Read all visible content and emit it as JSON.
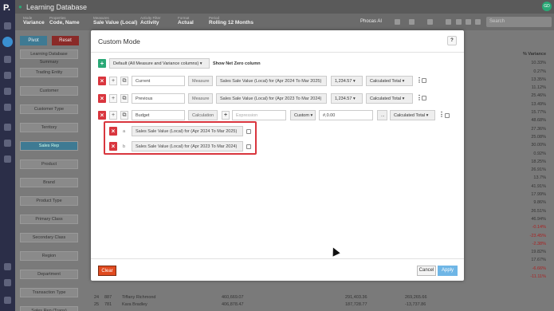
{
  "app": {
    "logo": "P.",
    "title": "Learning Database",
    "avatar": "GD"
  },
  "filters": [
    {
      "label": "Mode",
      "value": "Variance"
    },
    {
      "label": "Properties",
      "value": "Code, Name"
    },
    {
      "label": "Measures",
      "value": "Sale Value (Local)"
    },
    {
      "label": "Activity Filter",
      "value": "Activity"
    },
    {
      "label": "Format",
      "value": "Actual"
    },
    {
      "label": "Period",
      "value": "Rolling 12 Months"
    }
  ],
  "toolbar": {
    "phocas_ai": "Phocas AI",
    "search_placeholder": "Search"
  },
  "background": {
    "pivot_label": "Pivot",
    "reset_label": "Reset",
    "sidebar": [
      "Learning Database Summary",
      "Trading Entity",
      "Customer",
      "Customer Type",
      "Territory",
      "Sales Rep",
      "Product",
      "Brand",
      "Product Type",
      "Primary Class",
      "Secondary Class",
      "Region",
      "Department",
      "Transaction Type",
      "Sales Rep (Trans)"
    ],
    "variance_header": "% Variance",
    "variance_values": [
      "10.33%",
      "0.27%",
      "13.35%",
      "11.12%",
      "25.46%",
      "13.49%",
      "15.77%",
      "48.68%",
      "27.36%",
      "25.08%",
      "30.00%",
      "0.92%",
      "18.25%",
      "26.91%",
      "13.7%",
      "41.91%",
      "17.99%",
      "9.86%",
      "26.51%",
      "46.94%",
      "-0.14%",
      "-23.45%",
      "-2.38%",
      "19.82%",
      "17.67%",
      "-6.66%",
      "-11.11%"
    ],
    "rows": [
      {
        "num": "24",
        "code": "887",
        "name": "Tiffany Richmond",
        "a": "460,669.07",
        "b": "291,403.36",
        "c": "269,265.66"
      },
      {
        "num": "25",
        "code": "781",
        "name": "Kara Bradley",
        "a": "406,878.47",
        "b": "187,728.77",
        "c": "-13,737.86"
      }
    ]
  },
  "modal": {
    "title": "Custom Mode",
    "help_label": "?",
    "default_dropdown": "Default (All Measure and Variance columns)",
    "show_net_zero": "Show Net Zero column",
    "rows": [
      {
        "name": "Current",
        "type": "Measure",
        "measure": "Sales Sale Value (Local) for (Apr 2024 To Mar 2025)",
        "format": "1,234.57",
        "total": "Calculated Total"
      },
      {
        "name": "Previous",
        "type": "Measure",
        "measure": "Sales Sale Value (Local) for (Apr 2023 To Mar 2024)",
        "format": "1,234.57",
        "total": "Calculated Total"
      },
      {
        "name": "Budget",
        "type": "Calculation",
        "expression_placeholder": "Expression",
        "format_type": "Custom",
        "format": "#,0.00",
        "ellipsis": "...",
        "total": "Calculated Total"
      }
    ],
    "sub_rows": [
      {
        "letter": "a",
        "measure": "Sales Sale Value (Local) for (Apr 2024 To Mar 2025)"
      },
      {
        "letter": "b",
        "measure": "Sales Sale Value (Local) for (Apr 2023 To Mar 2024)"
      }
    ],
    "clear_label": "Clear",
    "cancel_label": "Cancel",
    "apply_label": "Apply"
  },
  "colors": {
    "accent": "#2aa876",
    "danger": "#d9363e",
    "apply": "#6fb6e6",
    "selected": "#3e7a93",
    "clear": "#e04a1f"
  }
}
